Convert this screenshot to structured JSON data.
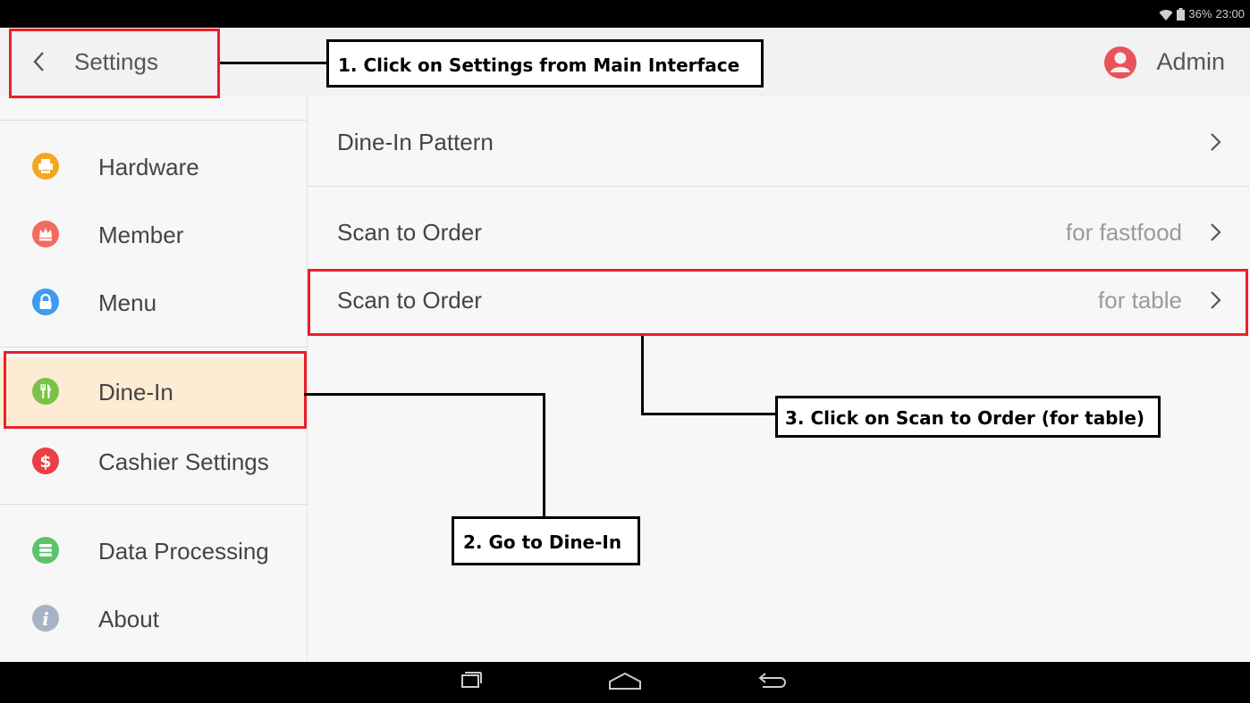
{
  "status_bar": {
    "battery": "36%",
    "time": "23:00"
  },
  "app_bar": {
    "title": "Settings",
    "user": "Admin"
  },
  "sidebar": {
    "items": [
      {
        "label": "Hardware",
        "icon": "printer-icon",
        "color": "#f5a623"
      },
      {
        "label": "Member",
        "icon": "crown-icon",
        "color": "#f26b5e"
      },
      {
        "label": "Menu",
        "icon": "lock-icon",
        "color": "#3f9af0"
      },
      {
        "label": "Dine-In",
        "icon": "fork-knife-icon",
        "color": "#7cc24a",
        "selected": true
      },
      {
        "label": "Cashier Settings",
        "icon": "dollar-icon",
        "color": "#ea3f44"
      },
      {
        "label": "Data Processing",
        "icon": "database-icon",
        "color": "#5cc36a"
      },
      {
        "label": "About",
        "icon": "info-icon",
        "color": "#a7b2c4"
      }
    ]
  },
  "content": {
    "rows": [
      {
        "label": "Dine-In Pattern",
        "hint": ""
      },
      {
        "label": "Scan to Order",
        "hint": "for fastfood"
      },
      {
        "label": "Scan to Order",
        "hint": "for table"
      }
    ]
  },
  "annotations": {
    "step1": "1. Click on Settings from Main Interface",
    "step2": "2. Go to Dine-In",
    "step3": "3. Click on Scan to Order (for table)"
  },
  "colors": {
    "highlight": "#e8202a",
    "selected_bg": "#fdebd4",
    "avatar": "#e9535a"
  }
}
